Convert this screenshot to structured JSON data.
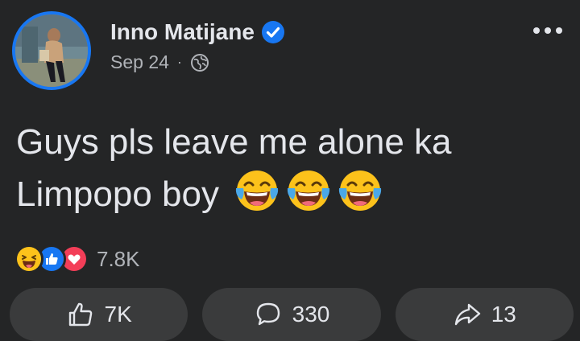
{
  "post": {
    "author": "Inno Matijane",
    "verified": true,
    "date": "Sep 24",
    "separator": "·",
    "audience_icon": "globe-icon",
    "text_line1": "Guys pls leave me alone ka",
    "text_line2": "Limpopo boy",
    "text_emojis": [
      "tears-of-joy-emoji",
      "tears-of-joy-emoji",
      "tears-of-joy-emoji"
    ]
  },
  "reactions": {
    "types": [
      "haha",
      "like",
      "love"
    ],
    "count": "7.8K"
  },
  "actions": {
    "like_count": "7K",
    "comment_count": "330",
    "share_count": "13"
  },
  "colors": {
    "background": "#242526",
    "accent": "#1877f2",
    "button_bg": "#3a3b3c",
    "love": "#f33e58"
  }
}
